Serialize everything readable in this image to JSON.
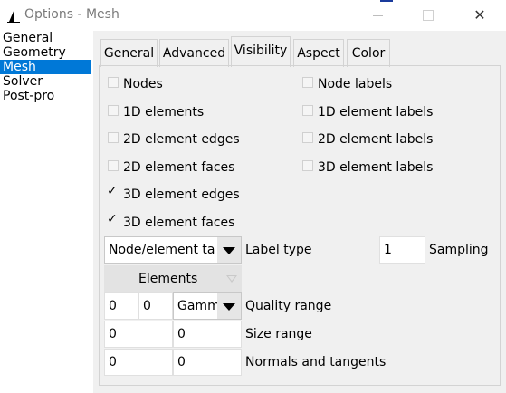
{
  "window": {
    "title": "Options - Mesh",
    "minimize_icon": "minimize-icon",
    "maximize_icon": "maximize-icon",
    "close_glyph": "✕"
  },
  "categories": {
    "items": [
      {
        "label": "General",
        "selected": false
      },
      {
        "label": "Geometry",
        "selected": false
      },
      {
        "label": "Mesh",
        "selected": true
      },
      {
        "label": "Solver",
        "selected": false
      },
      {
        "label": "Post-pro",
        "selected": false
      }
    ]
  },
  "tabs": {
    "items": [
      {
        "label": "General",
        "active": false
      },
      {
        "label": "Advanced",
        "active": false
      },
      {
        "label": "Visibility",
        "active": true
      },
      {
        "label": "Aspect",
        "active": false
      },
      {
        "label": "Color",
        "active": false
      }
    ]
  },
  "visibility": {
    "checks": {
      "nodes": {
        "label": "Nodes",
        "checked": false
      },
      "node_labels": {
        "label": "Node labels",
        "checked": false
      },
      "elements_1d": {
        "label": "1D elements",
        "checked": false
      },
      "element_labels_1d": {
        "label": "1D element labels",
        "checked": false
      },
      "element_edges_2d": {
        "label": "2D element edges",
        "checked": false
      },
      "element_labels_2d": {
        "label": "2D element labels",
        "checked": false
      },
      "element_faces_2d": {
        "label": "2D element faces",
        "checked": false
      },
      "element_labels_3d": {
        "label": "3D element labels",
        "checked": false
      },
      "element_edges_3d": {
        "label": "3D element edges",
        "checked": true
      },
      "element_faces_3d": {
        "label": "3D element faces",
        "checked": true
      }
    },
    "tick_glyph": "✓",
    "label_type": {
      "value": "Node/element tag",
      "label": "Label type"
    },
    "sampling": {
      "value": "1",
      "label": "Sampling"
    },
    "elements_select": {
      "value": "Elements"
    },
    "quality_range": {
      "min": "0",
      "max": "0",
      "measure": "Gamma",
      "label": "Quality range"
    },
    "size_range": {
      "min": "0",
      "max": "0",
      "label": "Size range"
    },
    "normals": {
      "normals": "0",
      "tangents": "0",
      "label": "Normals and tangents"
    }
  },
  "colors": {
    "selection": "#0078d7",
    "panel_bg": "#f0f0f0",
    "fragment_blue": "#1a3b9c"
  }
}
